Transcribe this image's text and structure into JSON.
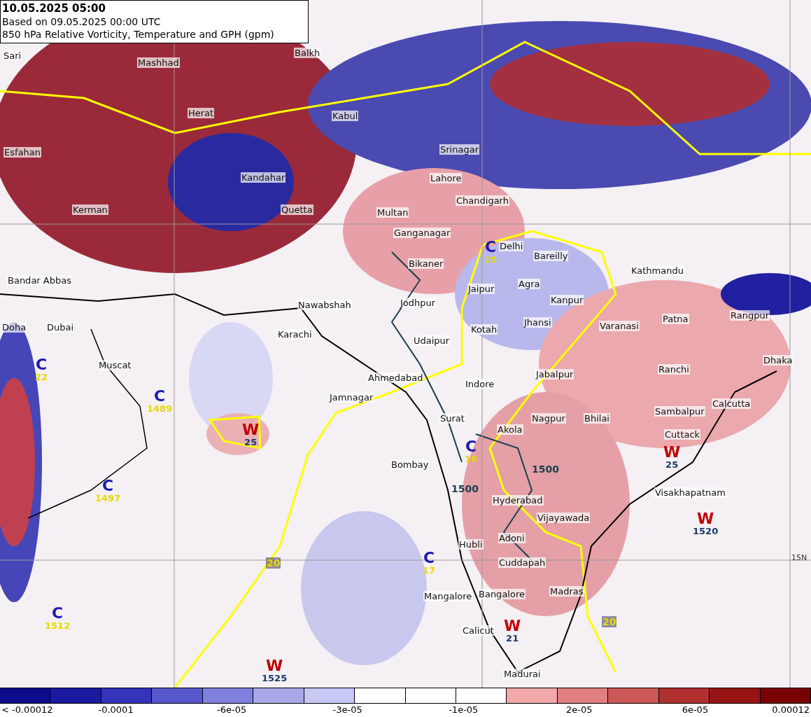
{
  "header": {
    "valid_time": "10.05.2025 05:00",
    "based_on": "Based on 09.05.2025 00:00 UTC",
    "title": "850 hPa Relative Vorticity, Temperature and GPH (gpm)"
  },
  "map": {
    "cities": [
      {
        "name": "Sari"
      },
      {
        "name": "Mashhad"
      },
      {
        "name": "Balkh"
      },
      {
        "name": "Herat"
      },
      {
        "name": "Kabul"
      },
      {
        "name": "Esfahan"
      },
      {
        "name": "Srinagar"
      },
      {
        "name": "Kandahar"
      },
      {
        "name": "Lahore"
      },
      {
        "name": "Chandigarh"
      },
      {
        "name": "Kerman"
      },
      {
        "name": "Quetta"
      },
      {
        "name": "Multan"
      },
      {
        "name": "Ganganagar"
      },
      {
        "name": "Delhi"
      },
      {
        "name": "Bareilly"
      },
      {
        "name": "Bikaner"
      },
      {
        "name": "Kathmandu"
      },
      {
        "name": "Bandar Abbas"
      },
      {
        "name": "Agra"
      },
      {
        "name": "Jaipur"
      },
      {
        "name": "Jodhpur"
      },
      {
        "name": "Kanpur"
      },
      {
        "name": "Nawabshah"
      },
      {
        "name": "Doha"
      },
      {
        "name": "Dubai"
      },
      {
        "name": "Jhansi"
      },
      {
        "name": "Varanasi"
      },
      {
        "name": "Patna"
      },
      {
        "name": "Rangpur"
      },
      {
        "name": "Karachi"
      },
      {
        "name": "Kotah"
      },
      {
        "name": "Udaipur"
      },
      {
        "name": "Dhaka"
      },
      {
        "name": "Muscat"
      },
      {
        "name": "Ranchi"
      },
      {
        "name": "Jabalpur"
      },
      {
        "name": "Ahmedabad"
      },
      {
        "name": "Indore"
      },
      {
        "name": "Jamnagar"
      },
      {
        "name": "Calcutta"
      },
      {
        "name": "Sambalpur"
      },
      {
        "name": "Surat"
      },
      {
        "name": "Nagpur"
      },
      {
        "name": "Bhilai"
      },
      {
        "name": "Akola"
      },
      {
        "name": "Cuttack"
      },
      {
        "name": "Bombay"
      },
      {
        "name": "Visakhapatnam"
      },
      {
        "name": "Hyderabad"
      },
      {
        "name": "Vijayawada"
      },
      {
        "name": "Adoni"
      },
      {
        "name": "Hubli"
      },
      {
        "name": "Cuddapah"
      },
      {
        "name": "Madras"
      },
      {
        "name": "Mangalore"
      },
      {
        "name": "Bangalore"
      },
      {
        "name": "Calicut"
      },
      {
        "name": "Madurai"
      }
    ],
    "systems": [
      {
        "kind": "cold",
        "letter": "C",
        "value": "19"
      },
      {
        "kind": "cold",
        "letter": "C",
        "value": "22"
      },
      {
        "kind": "cold",
        "letter": "C",
        "value": "1489"
      },
      {
        "kind": "warm",
        "letter": "W",
        "value": "25"
      },
      {
        "kind": "cold",
        "letter": "C",
        "value": "18"
      },
      {
        "kind": "warm",
        "letter": "W",
        "value": "25"
      },
      {
        "kind": "cold",
        "letter": "C",
        "value": "1497"
      },
      {
        "kind": "warm",
        "letter": "W",
        "value": "1520"
      },
      {
        "kind": "cold",
        "letter": "C",
        "value": "17"
      },
      {
        "kind": "cold",
        "letter": "C",
        "value": "1512"
      },
      {
        "kind": "warm",
        "letter": "W",
        "value": "21"
      },
      {
        "kind": "warm",
        "letter": "W",
        "value": "1525"
      }
    ],
    "contour_labels": [
      {
        "text": "1500"
      },
      {
        "text": "1500"
      },
      {
        "text": "20"
      },
      {
        "text": "20"
      },
      {
        "text": "15N"
      }
    ]
  },
  "colorbar": {
    "swatches": [
      {
        "color": "#0c0c8c"
      },
      {
        "color": "#1a1aa0"
      },
      {
        "color": "#3333bb"
      },
      {
        "color": "#5858cc"
      },
      {
        "color": "#8080dd"
      },
      {
        "color": "#a8a8e8"
      },
      {
        "color": "#c8c8f5"
      },
      {
        "color": "#ffffff"
      },
      {
        "color": "#ffffff"
      },
      {
        "color": "#ffffff"
      },
      {
        "color": "#f0a8a8"
      },
      {
        "color": "#e08080"
      },
      {
        "color": "#cc5858"
      },
      {
        "color": "#b03030"
      },
      {
        "color": "#961414"
      },
      {
        "color": "#7a0000"
      }
    ],
    "labels": [
      "< -0.00012",
      "-0.0001",
      "-6e-05",
      "-3e-05",
      "-1e-05",
      "2e-05",
      "6e-05",
      "0.00012"
    ]
  }
}
